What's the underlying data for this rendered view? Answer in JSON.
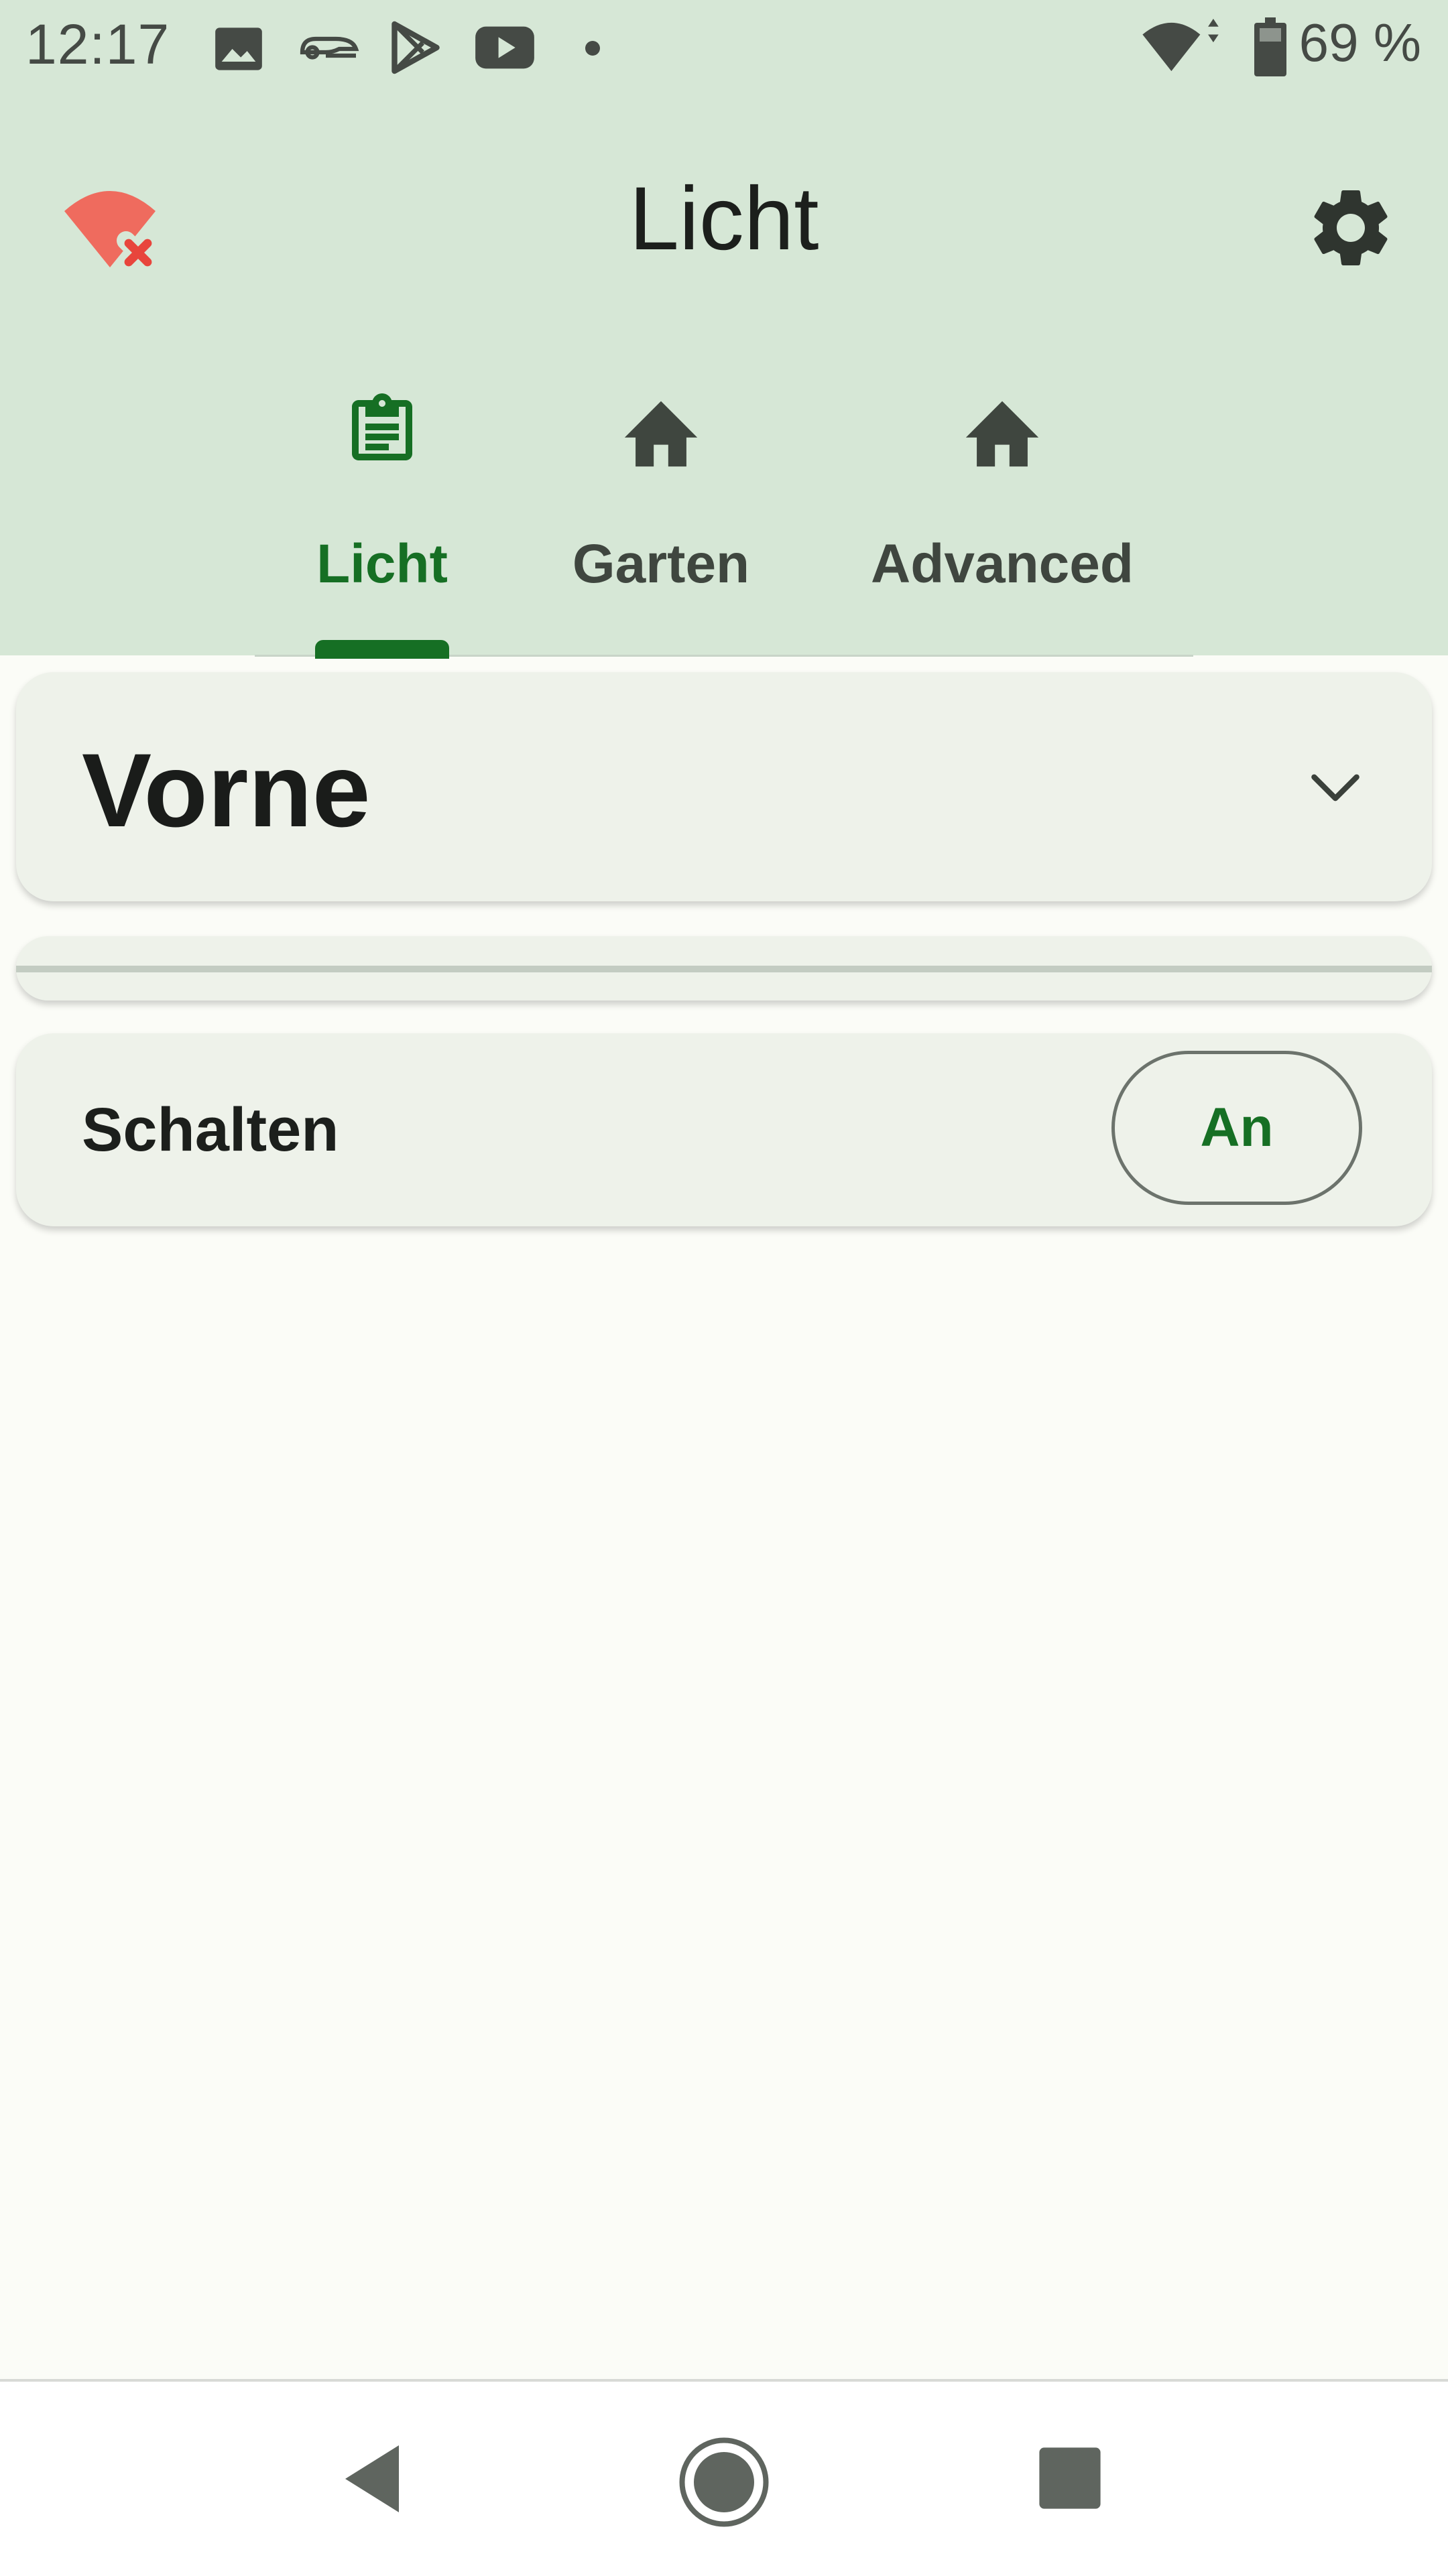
{
  "status_bar": {
    "time": "12:17",
    "notification_icons": [
      "image-icon",
      "cobra-icon",
      "play-store-icon",
      "youtube-icon",
      "dot-icon"
    ],
    "system_icons": [
      "wifi-icon",
      "battery-icon"
    ],
    "battery": "69 %"
  },
  "toolbar": {
    "title": "Licht",
    "left_icon": "wifi-off-icon",
    "right_icon": "settings-gear-icon"
  },
  "tabs": [
    {
      "label": "Licht",
      "icon": "clipboard-icon",
      "active": true
    },
    {
      "label": "Garten",
      "icon": "home-icon",
      "active": false
    },
    {
      "label": "Advanced",
      "icon": "home-icon",
      "active": false
    }
  ],
  "section": {
    "title": "Vorne",
    "expand_icon": "chevron-down-icon"
  },
  "switch_row": {
    "label": "Schalten",
    "button_label": "An"
  },
  "colors": {
    "header_bg": "#d6e7d6",
    "accent": "#166f24",
    "page_bg": "#fbfcf7",
    "card_bg": "#eef2ea",
    "wifi_off_red": "#ef6b5e"
  },
  "nav_bar": [
    "back-icon",
    "home-circle-icon",
    "recents-icon"
  ]
}
